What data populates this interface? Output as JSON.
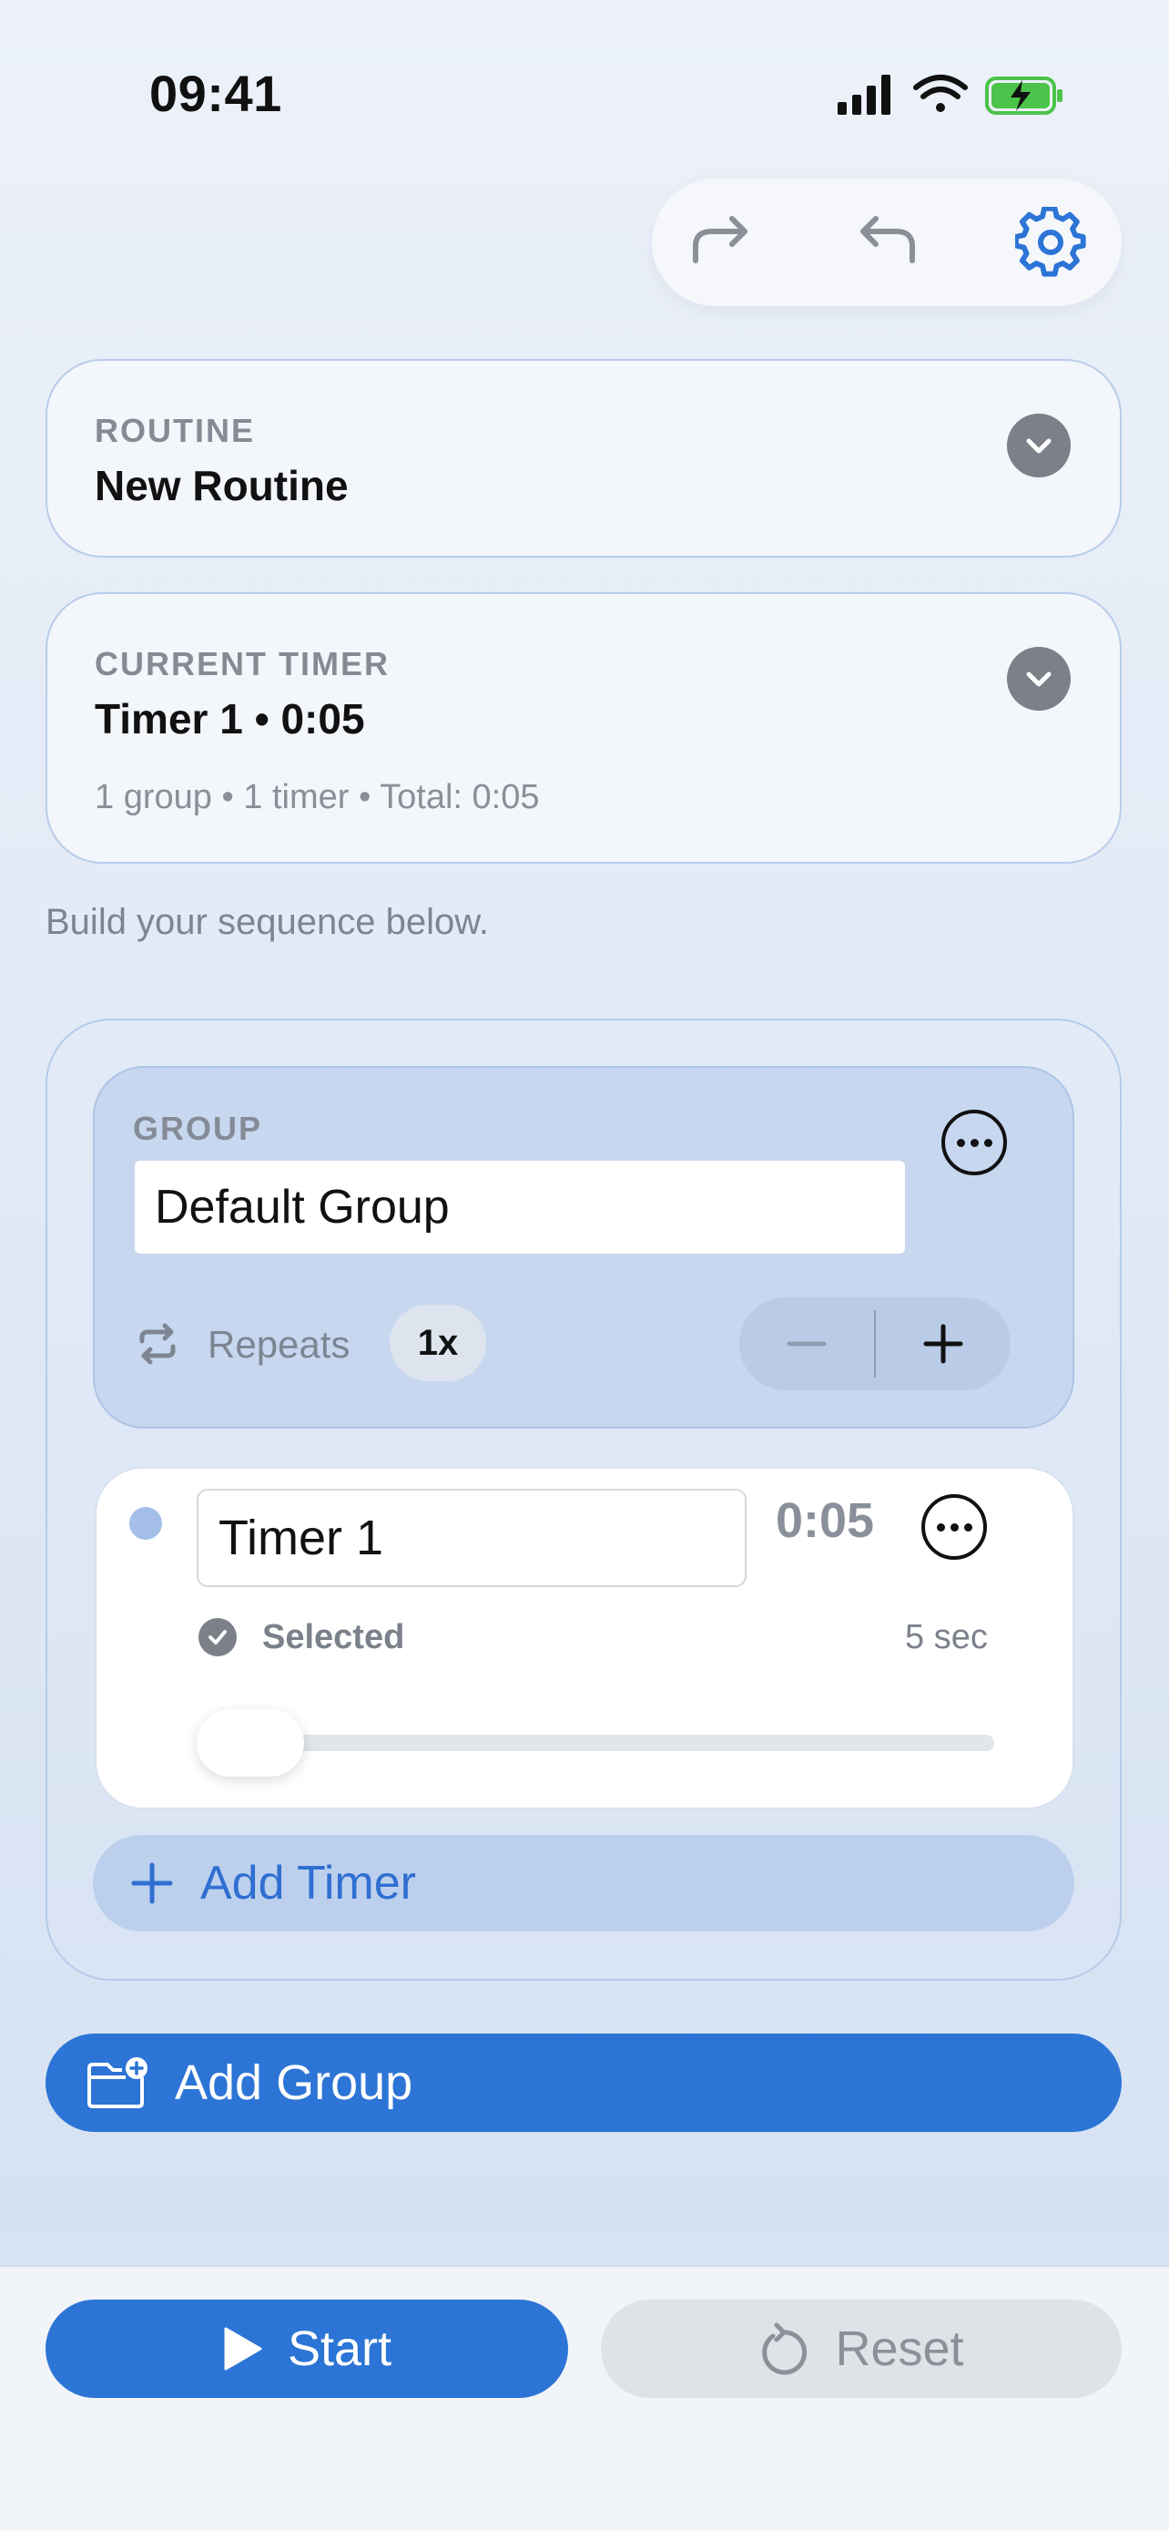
{
  "status_bar": {
    "time": "09:41",
    "icons": [
      "signal-icon",
      "wifi-icon",
      "battery-charging-icon"
    ]
  },
  "toolbar": {
    "buttons": [
      "redo-icon",
      "undo-icon",
      "settings-gear-icon"
    ],
    "accent_color": "#2c74d6"
  },
  "routine": {
    "label": "ROUTINE",
    "name": "New Routine"
  },
  "current_timer": {
    "label": "CURRENT TIMER",
    "title": "Timer 1 • 0:05",
    "summary": "1 group • 1 timer • Total: 0:05"
  },
  "hint": "Build your sequence below.",
  "group": {
    "label": "GROUP",
    "name_value": "Default Group",
    "repeats_label": "Repeats",
    "repeat_count": "1x",
    "timer": {
      "name_value": "Timer 1",
      "duration": "0:05",
      "status": "Selected",
      "seconds_label": "5 sec",
      "slider_fraction": 0.0
    },
    "add_timer_label": "Add Timer"
  },
  "add_group_label": "Add Group",
  "bottom": {
    "start_label": "Start",
    "reset_label": "Reset"
  }
}
